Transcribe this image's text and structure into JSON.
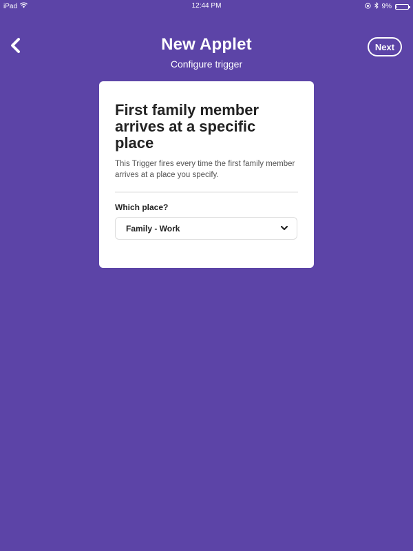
{
  "status_bar": {
    "device": "iPad",
    "time": "12:44 PM",
    "battery_text": "9%",
    "battery_level": 0.09,
    "wifi_icon": "wifi-icon",
    "location_icon": "location-icon",
    "bluetooth_icon": "bluetooth-icon"
  },
  "header": {
    "back_icon": "chevron-left-icon",
    "title": "New Applet",
    "subtitle": "Configure trigger",
    "next_label": "Next"
  },
  "card": {
    "title": "First family member arrives at a specific place",
    "description": "This Trigger fires every time the first family member arrives at a place you specify.",
    "field_label": "Which place?",
    "select_value": "Family - Work",
    "select_icon": "chevron-down-icon"
  },
  "colors": {
    "background": "#5c44a7",
    "card": "#ffffff",
    "text_dark": "#222222"
  }
}
